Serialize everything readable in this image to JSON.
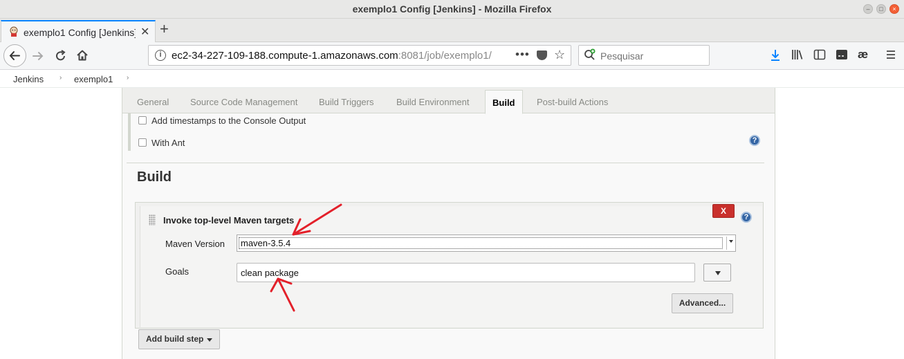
{
  "window": {
    "title": "exemplo1 Config [Jenkins] - Mozilla Firefox"
  },
  "browser": {
    "tab_title": "exemplo1 Config [Jenkins]",
    "url_host": "ec2-34-227-109-188.compute-1.amazonaws.com",
    "url_rest": ":8081/job/exemplo1/",
    "search_placeholder": "Pesquisar",
    "overflow_label": "•••"
  },
  "breadcrumb": [
    "Jenkins",
    "exemplo1"
  ],
  "config_tabs": [
    {
      "label": "General",
      "active": false
    },
    {
      "label": "Source Code Management",
      "active": false
    },
    {
      "label": "Build Triggers",
      "active": false
    },
    {
      "label": "Build Environment",
      "active": false
    },
    {
      "label": "Build",
      "active": true
    },
    {
      "label": "Post-build Actions",
      "active": false
    }
  ],
  "build_env": {
    "options": [
      {
        "label": "Add timestamps to the Console Output",
        "checked": false
      },
      {
        "label": "With Ant",
        "checked": false
      }
    ]
  },
  "build": {
    "heading": "Build",
    "step": {
      "title": "Invoke top-level Maven targets",
      "delete_label": "X",
      "maven_version_label": "Maven Version",
      "maven_version_value": "maven-3.5.4",
      "goals_label": "Goals",
      "goals_value": "clean package",
      "advanced_label": "Advanced..."
    },
    "add_step_label": "Add build step"
  },
  "icons": {
    "help": "?",
    "annotation_color": "#e3202a"
  }
}
